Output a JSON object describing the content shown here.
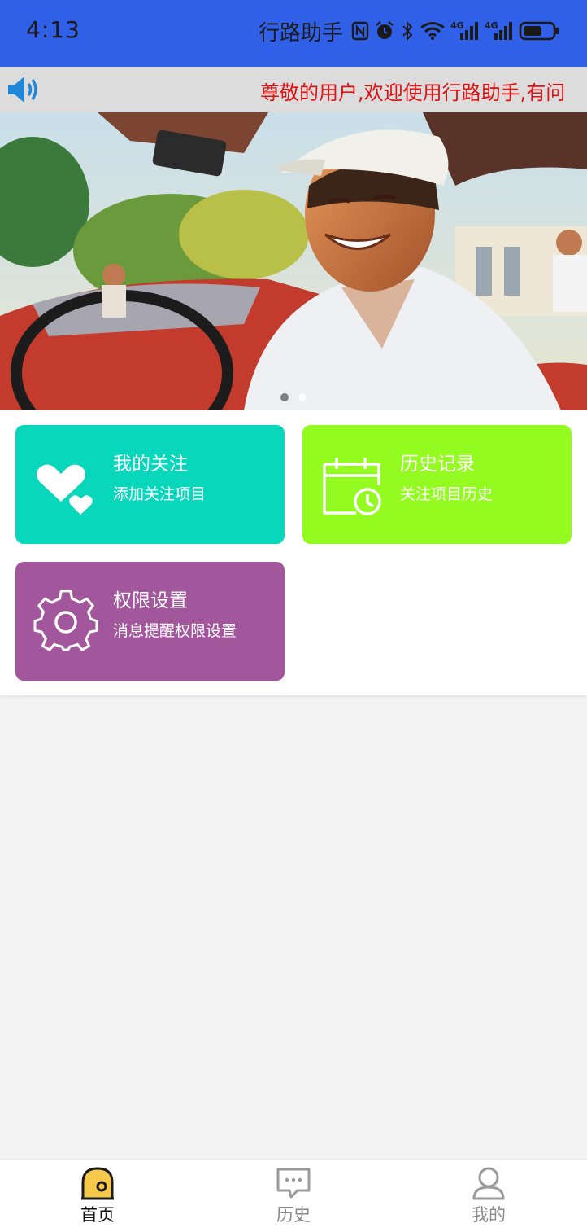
{
  "status_bar": {
    "time": "4:13",
    "app_title": "行路助手",
    "network_1": "4G",
    "network_2": "4G"
  },
  "notice": {
    "text": "尊敬的用户,欢迎使用行路助手,有问"
  },
  "cards": [
    {
      "title": "我的关注",
      "subtitle": "添加关注项目",
      "color": "#08d7bb",
      "icon": "hearts-icon"
    },
    {
      "title": "历史记录",
      "subtitle": "关注项目历史",
      "color": "#93fb1f",
      "icon": "calendar-clock-icon"
    },
    {
      "title": "权限设置",
      "subtitle": "消息提醒权限设置",
      "color": "#a2569b",
      "icon": "gear-icon"
    }
  ],
  "bottom_nav": [
    {
      "label": "首页",
      "icon": "home-icon",
      "active": true
    },
    {
      "label": "历史",
      "icon": "chat-icon",
      "active": false
    },
    {
      "label": "我的",
      "icon": "user-icon",
      "active": false
    }
  ],
  "colors": {
    "status_bar": "#3060e8",
    "notice_text": "#e01010",
    "nav_active": "#111111",
    "nav_inactive": "#8a8a8a"
  }
}
